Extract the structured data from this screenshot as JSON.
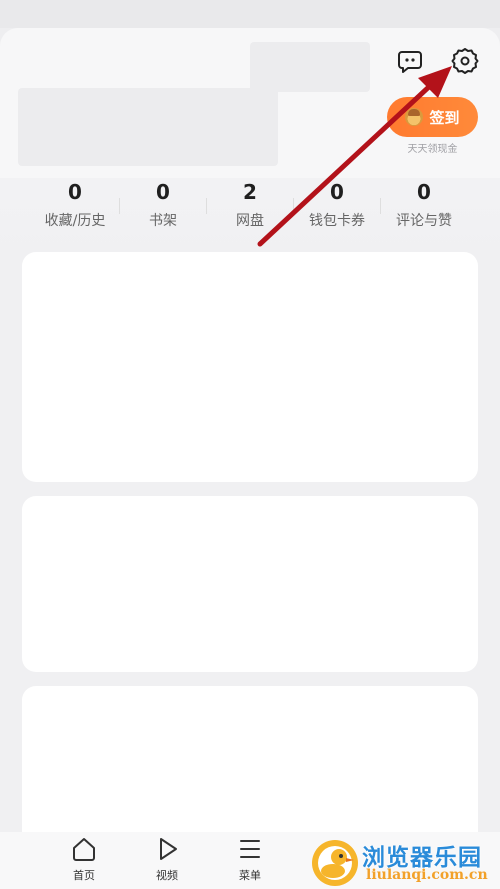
{
  "header": {
    "message_icon": "chat-bubble-icon",
    "settings_icon": "gear-icon",
    "checkin_label": "签到",
    "checkin_subtitle": "天天领现金"
  },
  "stats": [
    {
      "value": "0",
      "label": "收藏/历史"
    },
    {
      "value": "0",
      "label": "书架"
    },
    {
      "value": "2",
      "label": "网盘"
    },
    {
      "value": "0",
      "label": "钱包卡券"
    },
    {
      "value": "0",
      "label": "评论与赞"
    }
  ],
  "tabs": [
    {
      "label": "首页",
      "icon": "home-icon"
    },
    {
      "label": "视频",
      "icon": "play-icon"
    },
    {
      "label": "菜单",
      "icon": "menu-icon"
    }
  ],
  "annotation": {
    "color": "#b3121a",
    "icon": "red-arrow-pointing-settings"
  },
  "watermark": {
    "title": "浏览器乐园",
    "url": "liulanqi.com.cn"
  }
}
